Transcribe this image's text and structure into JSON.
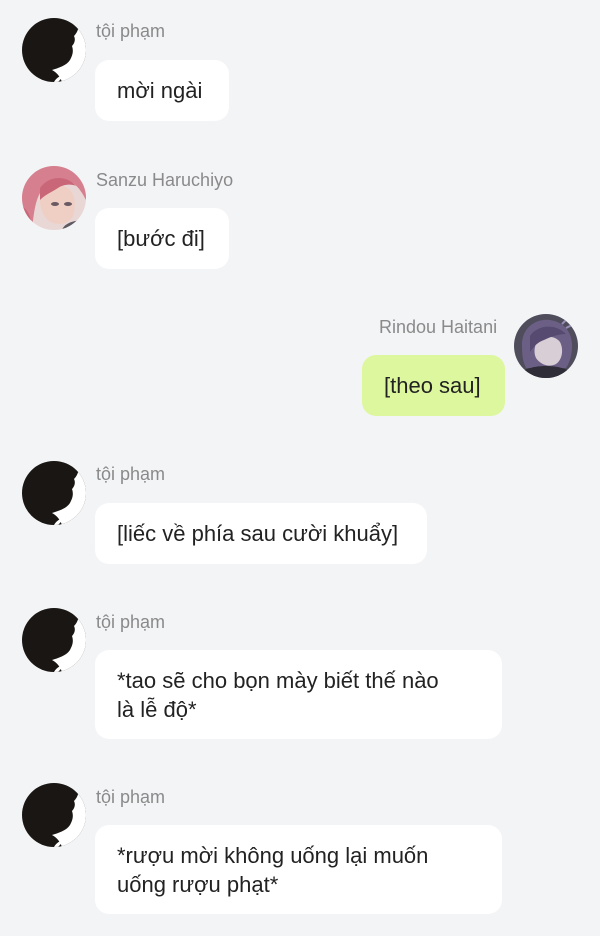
{
  "messages": [
    {
      "sender": "tội phạm",
      "text": "mời ngài",
      "avatar_icon": "silhouette-avatar-icon",
      "outgoing": false
    },
    {
      "sender": "Sanzu Haruchiyo",
      "text": "[bước đi]",
      "avatar_icon": "pink-haired-character-avatar-icon",
      "outgoing": false
    },
    {
      "sender": "Rindou Haitani",
      "text": "[theo sau]",
      "avatar_icon": "purple-haired-character-avatar-icon",
      "outgoing": true
    },
    {
      "sender": "tội phạm",
      "text": "[liếc về phía sau cười khuẩy]",
      "avatar_icon": "silhouette-avatar-icon",
      "outgoing": false
    },
    {
      "sender": "tội phạm",
      "text": "*tao sẽ cho bọn mày biết thế nào\nlà lễ độ*",
      "avatar_icon": "silhouette-avatar-icon",
      "outgoing": false
    },
    {
      "sender": "tội phạm",
      "text": "*rượu mời không uống lại muốn\nuống rượu phạt*",
      "avatar_icon": "silhouette-avatar-icon",
      "outgoing": false
    }
  ],
  "colors": {
    "background": "#f3f4f6",
    "incoming_bubble": "#ffffff",
    "outgoing_bubble": "#ddf79e",
    "sender_name": "#8a8a8a",
    "message_text": "#222222"
  }
}
